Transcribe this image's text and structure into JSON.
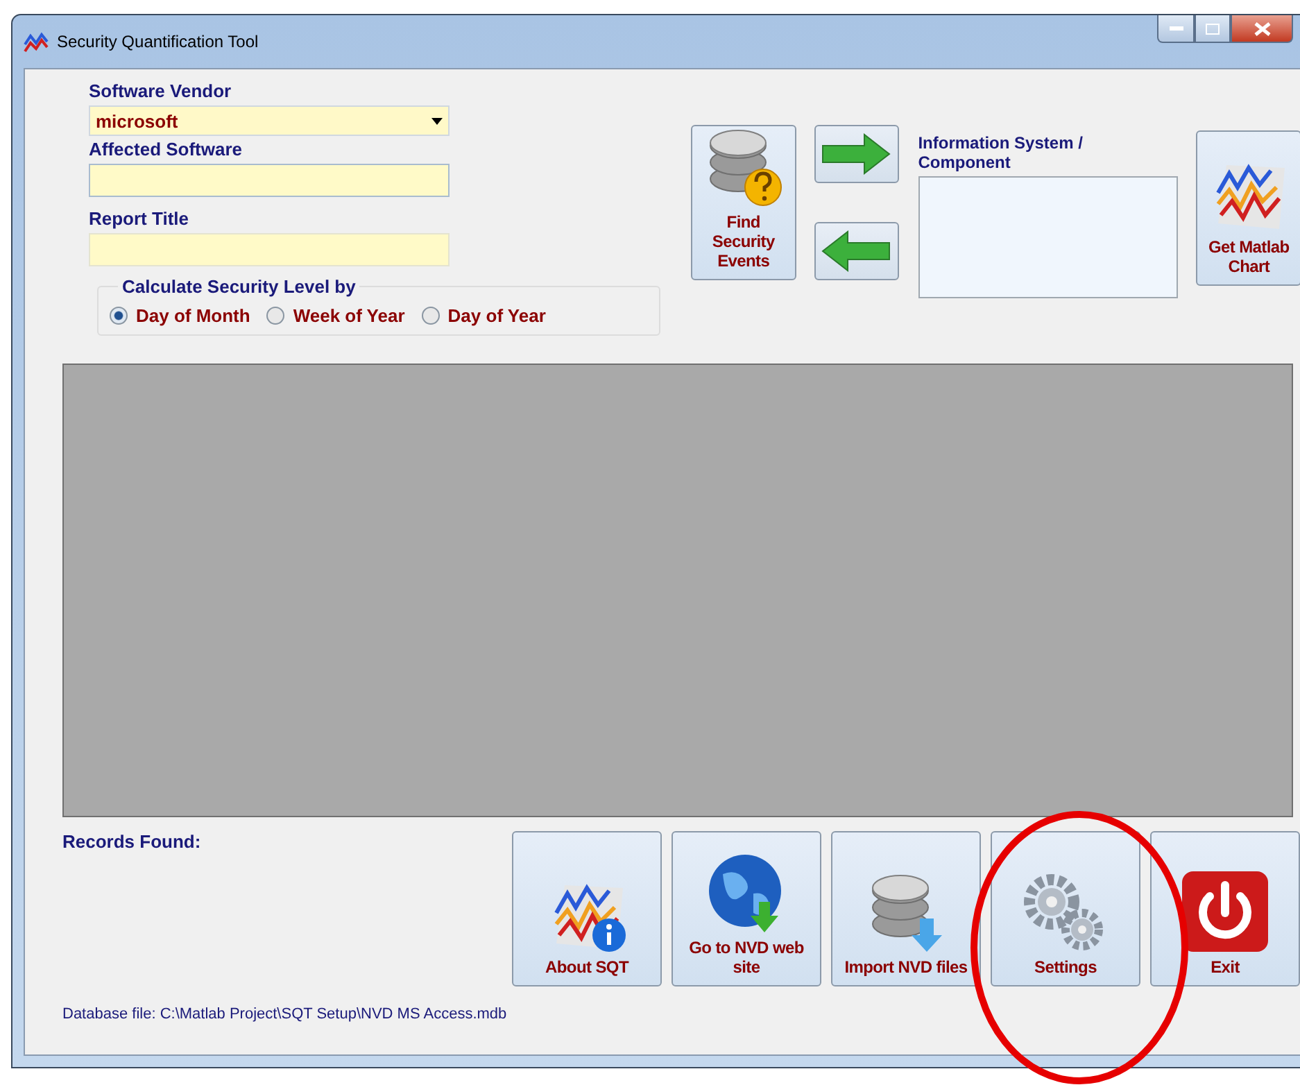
{
  "window": {
    "title": "Security Quantification Tool"
  },
  "vendor": {
    "label": "Software Vendor",
    "value": "microsoft"
  },
  "affected": {
    "label": "Affected Software"
  },
  "report": {
    "label": "Report Title"
  },
  "find_button": {
    "label": "Find Security Events"
  },
  "info": {
    "label": "Information System / Component"
  },
  "matlab_button": {
    "label": "Get Matlab Chart"
  },
  "calc": {
    "title": "Calculate Security Level by",
    "options": [
      {
        "label": "Day of Month",
        "selected": true
      },
      {
        "label": "Week of Year",
        "selected": false
      },
      {
        "label": "Day of Year",
        "selected": false
      }
    ]
  },
  "records_label": "Records Found:",
  "actions": [
    {
      "label": "About SQT"
    },
    {
      "label": "Go to NVD web site"
    },
    {
      "label": "Import NVD files"
    },
    {
      "label": "Settings"
    },
    {
      "label": "Exit"
    }
  ],
  "status": "Database file: C:\\Matlab Project\\SQT Setup\\NVD MS Access.mdb"
}
